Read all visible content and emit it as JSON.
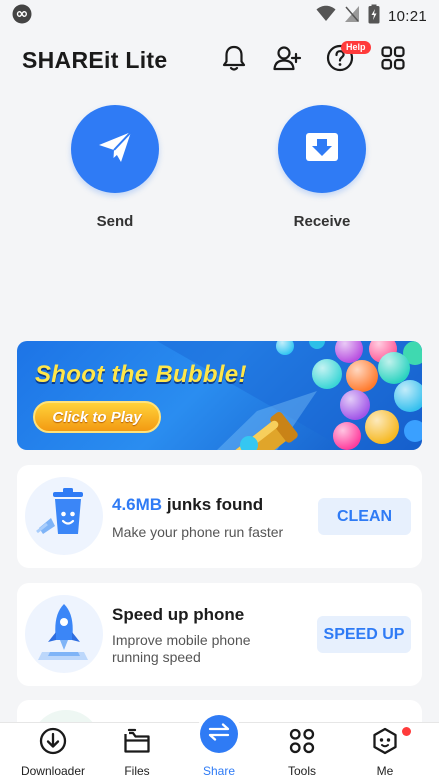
{
  "status_bar": {
    "time": "10:21",
    "icons": [
      "infinity-icon",
      "wifi-icon",
      "signal-icon",
      "battery-icon"
    ]
  },
  "header": {
    "title": "SHAREit Lite",
    "icons": [
      "bell-icon",
      "add-user-icon",
      "help-icon",
      "apps-grid-icon"
    ],
    "help_badge": "Help"
  },
  "actions": [
    {
      "label": "Send",
      "icon": "paper-plane-icon"
    },
    {
      "label": "Receive",
      "icon": "download-box-icon"
    }
  ],
  "banner": {
    "title": "Shoot the Bubble!",
    "button": "Click to Play"
  },
  "cards": {
    "clean": {
      "size": "4.6MB",
      "title_rest": "junks found",
      "subtitle": "Make your phone run faster",
      "button": "CLEAN",
      "icon": "trash-bin-icon"
    },
    "speed": {
      "title": "Speed up phone",
      "subtitle": "Improve mobile phone running speed",
      "button": "SPEED UP",
      "icon": "rocket-icon"
    }
  },
  "bottom_nav": [
    {
      "label": "Downloader",
      "icon": "download-circle-icon"
    },
    {
      "label": "Files",
      "icon": "folder-icon"
    },
    {
      "label": "Share",
      "icon": "transfer-arrows-icon",
      "active": true
    },
    {
      "label": "Tools",
      "icon": "tools-grid-icon"
    },
    {
      "label": "Me",
      "icon": "face-icon",
      "badge": true
    }
  ],
  "colors": {
    "accent": "#2f7bf5",
    "background": "#f4f5f7",
    "badge": "#ff3b3b"
  }
}
